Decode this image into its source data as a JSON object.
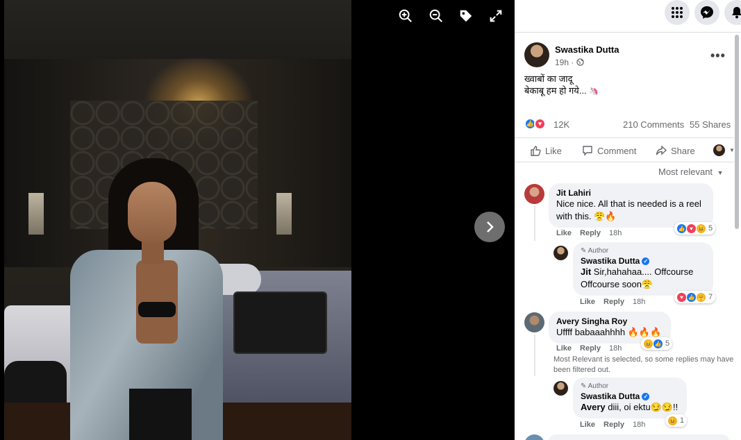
{
  "viewer": {
    "tools": [
      {
        "icon": "zoom-in-icon"
      },
      {
        "icon": "zoom-out-icon"
      },
      {
        "icon": "tag-icon"
      },
      {
        "icon": "fullscreen-icon"
      }
    ],
    "next_icon": "chevron-right-icon"
  },
  "topbar": {
    "icons": [
      "apps-grid-icon",
      "messenger-icon",
      "notifications-bell-icon"
    ]
  },
  "post": {
    "author": "Swastika Dutta",
    "time": "19h",
    "line1": "ख्वाबों का जादू",
    "line2": "बेकाबू हम हो गये... ",
    "reaction_count": "12K",
    "comments": "210 Comments",
    "shares": "55 Shares",
    "actions": {
      "like": "Like",
      "comment": "Comment",
      "share": "Share"
    },
    "sort": "Most relevant"
  },
  "comments": [
    {
      "name": "Jit Lahiri",
      "text": "Nice nice. All that is needed is a reel with this. 😤🔥",
      "like": "Like",
      "reply": "Reply",
      "time": "18h",
      "reaction_count": "5"
    },
    {
      "author_tag": "Author",
      "name": "Swastika Dutta",
      "mention": "Jit",
      "text": " Sir,hahahaa.... Offcourse Offcourse soon😤",
      "like": "Like",
      "reply": "Reply",
      "time": "18h",
      "reaction_count": "7"
    },
    {
      "name": "Avery Singha Roy",
      "text": "Uffff babaaahhhh 🔥🔥🔥",
      "like": "Like",
      "reply": "Reply",
      "time": "18h",
      "reaction_count": "5",
      "note": "Most Relevant is selected, so some replies may have been filtered out."
    },
    {
      "author_tag": "Author",
      "name": "Swastika Dutta",
      "mention": "Avery",
      "text": " diii, oi ektu😏😏!!",
      "like": "Like",
      "reply": "Reply",
      "time": "18h",
      "reaction_count": "1"
    }
  ],
  "colors": {
    "facebook_blue": "#1877f2",
    "love_red": "#f33e58",
    "haha_yellow": "#f7b125"
  }
}
